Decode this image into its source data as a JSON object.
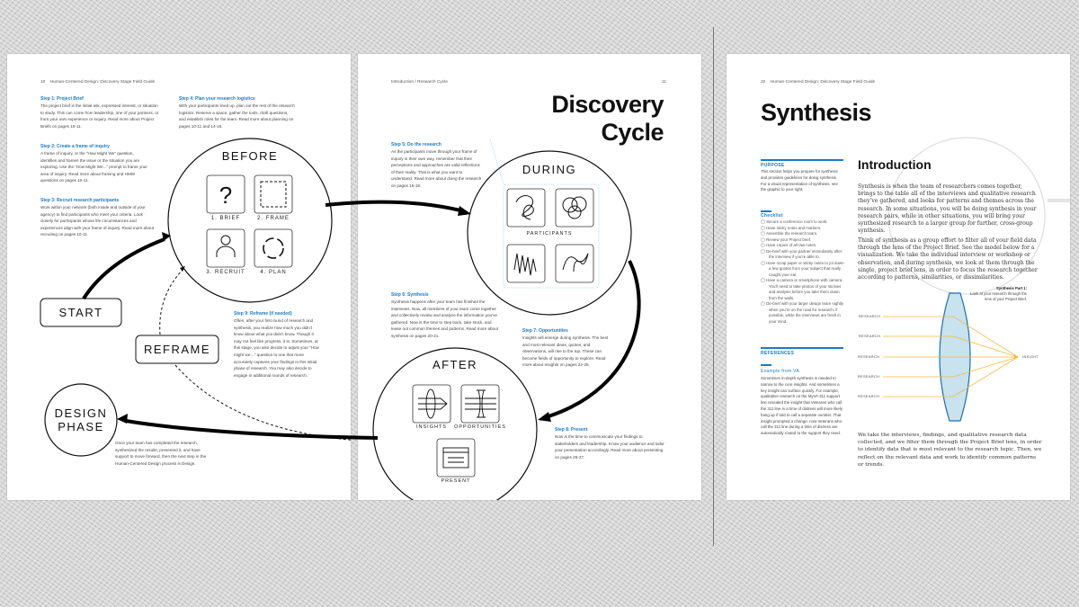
{
  "left_page": {
    "header": {
      "page_number": "10",
      "title": "Human-Centered Design: Discovery Stage Field Guide"
    },
    "steps": [
      {
        "title": "Step 1: Project Brief",
        "body": "The project brief is the initial ask, expressed interest, or situation to study. This can come from leadership, one of your partners, or from your own experience or inquiry. Read more about Project Briefs on pages 10-11."
      },
      {
        "title": "Step 2: Create a frame of inquiry",
        "body": "A frame of inquiry, or the “How Might We” question, identifies and frames the issue or the situation you are exploring. Use the “How Might We...” prompt to frame your area of inquiry. Read more about framing and HMW questions on pages 10-11."
      },
      {
        "title": "Step 3: Recruit research participants",
        "body": "Work within your network (both inside and outside of your agency) to find participants who meet your criteria. Look closely for participants whose life circumstances and experiences align with your frame of inquiry. Read more about recruiting on pages 10-11."
      },
      {
        "title": "Step 4: Plan your research logistics",
        "body": "With your participants lined up, plan out the rest of the research logistics. Reserve a space, gather the tools, draft questions, and establish roles for the team. Read more about planning on pages 10-11 and 14-15."
      },
      {
        "title": "Step 9: Reframe (if needed)",
        "body": "Often, after your first round of research and synthesis, you realize how much you didn’t know about what you didn’t know. Though it may not feel like progress, it is. Sometimes, at this stage, you also decide to adjust your “How might we…” question to one that more accurately captures your findings in this initial phase of research. You may also decide to engage in additional rounds of research."
      }
    ],
    "before": {
      "title": "BEFORE",
      "items": [
        "1. BRIEF",
        "2. FRAME",
        "3. RECRUIT",
        "4. PLAN"
      ]
    },
    "start_label": "START",
    "reframe_label": "REFRAME",
    "design_phase": [
      "DESIGN",
      "PHASE"
    ],
    "design_text": "Once your team has completed the research, synthesized the results, presented it, and have support to move forward, then the next step in the Human-Centered Design process is Design."
  },
  "middle_page": {
    "header": {
      "section": "Introduction / Research Cycle",
      "page_number": "11"
    },
    "title": "Discovery Cycle",
    "steps": [
      {
        "title": "Step 5: Do the research",
        "body": "As the participants move through your frame of inquiry in their own way, remember that their perceptions and approaches are valid reflections of their reality. That is what you want to understand. Read more about doing the research on pages 16-19."
      },
      {
        "title": "Step 6: Synthesis",
        "body": "Synthesis happens after your team has finished the interviews. Now, all members of your team come together and collectively review and analyze the information you’ve gathered. Now is the time to step back, take stock, and tease out common themes and patterns. Read more about synthesis on pages 20-21."
      },
      {
        "title": "Step 7: Opportunities",
        "body": "Insights will emerge during synthesis. The best and most relevant ideas, quotes, and observations, will rise to the top. These can become fields of opportunity to explore. Read more about Insights on pages 22-25."
      },
      {
        "title": "Step 8: Present",
        "body": "Now is the time to communicate your findings to stakeholders and leadership. Know your audience and tailor your presentation accordingly. Read more about presenting on pages 26-27."
      }
    ],
    "during": {
      "title": "DURING",
      "label": "PARTICIPANTS"
    },
    "after": {
      "title": "AFTER",
      "items": [
        "INSIGHTS",
        "OPPORTUNITIES",
        "PRESENT"
      ]
    }
  },
  "right_page": {
    "header": {
      "page_number": "22",
      "title": "Human-Centered Design: Discovery Stage Field Guide"
    },
    "title": "Synthesis",
    "purpose": {
      "label": "PURPOSE",
      "body": "This section helps you prepare for synthesis and provides guidelines for doing synthesis. For a visual representation of synthesis, see the graphic to your right."
    },
    "checklist": {
      "label": "Checklist",
      "items": [
        "Secure a conference room to work.",
        "Have sticky notes and markers.",
        "Assemble the research team.",
        "Review your Project brief.",
        "Have copies of all raw notes.",
        "De-brief with your partner immediately after the interview if you’re able to.",
        "Have scrap paper or sticky notes to jot down a few quotes from your subject that really caught your ear.",
        "Have a camera or smartphone with camera. You’ll need to take photos of your stickies and analysis before you take them down from the walls.",
        "De-brief with your larger design team nightly when you’re on the road for research, if possible, while the interviews are fresh in your mind."
      ]
    },
    "references": {
      "label": "REFERENCES",
      "example_title": "Example from VA",
      "example_body": "Sometimes in-depth synthesis is needed to narrow to the core insights. And sometimes a key insight can surface quickly. For example, qualitative research on the MyVA 311 support line revealed the insight that Veterans who call the 311 line in a time of distress will more likely hang up if told to call a separate number. That insight prompted a change: now Veterans who call the 311 line during a time of distress are automatically routed to the support they need."
    },
    "intro": {
      "title": "Introduction",
      "p1": "Synthesis is when the team of researchers comes together, brings to the table all of the interviews and qualitative research they’ve gathered, and looks for patterns and themes across the research. In some situations, you will be doing synthesis in your research pairs, while in other situations, you will bring your synthesized research to a larger group for further, cross-group synthesis.",
      "p2": "Think of synthesis as a group effort to filter all of your field data through the lens of the Project Brief. See the model below for a visualization. We take the individual interview or workshop or observation, and during synthesis, we look at them through the single, project brief lens, in order to focus the research together according to patterns, similarities, or dissimilarities.",
      "p3": "We take the interviews, findings, and qualitative research data collected, and we filter them through the Project Brief lens, in order to identify data that is most relevant to the research topic. Then, we reflect on the relevant data and work to identify common patterns or trends."
    },
    "lens": {
      "caption_title": "Synthesis Part 1:",
      "caption_body": "Look at your research through the lens of your Project Brief.",
      "inputs": [
        "RESEARCH",
        "RESEARCH",
        "RESEARCH",
        "RESEARCH",
        "RESEARCH"
      ],
      "output": "INSIGHT"
    }
  },
  "colors": {
    "accent": "#1a7bc4",
    "ray": "#f5b942",
    "lens_fill": "#c8e2ee",
    "lens_stroke": "#1a6fb5"
  }
}
